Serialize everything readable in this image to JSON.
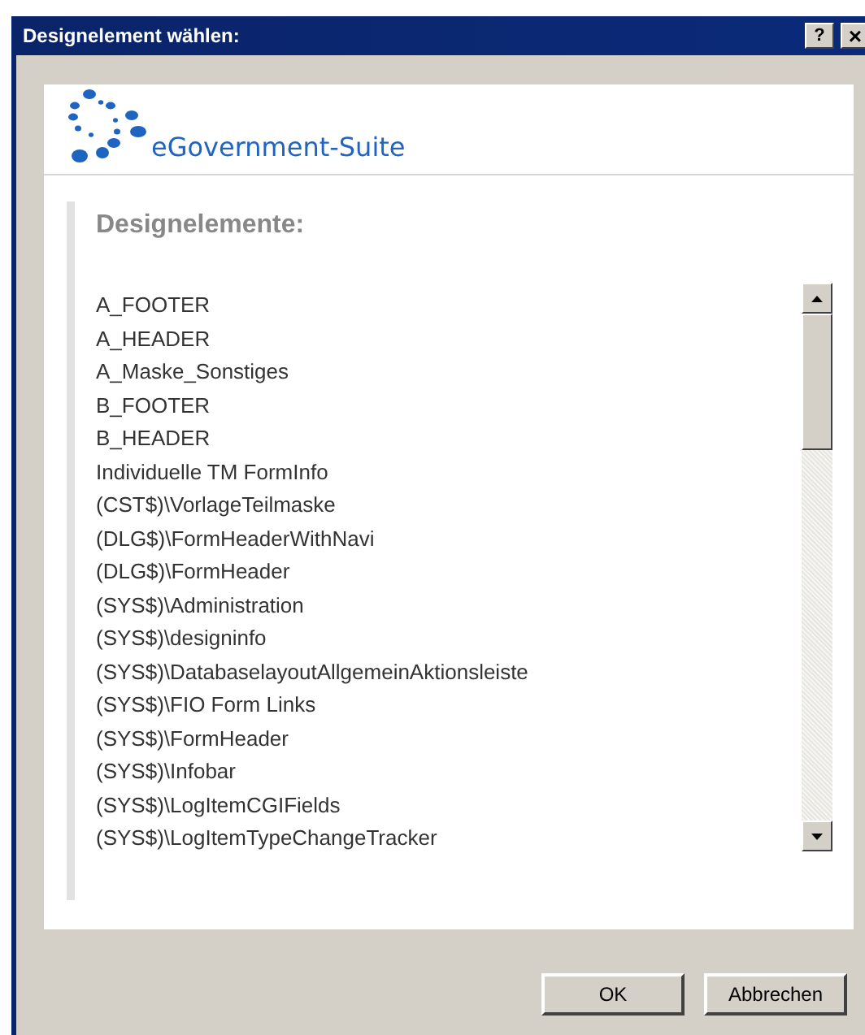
{
  "window": {
    "title": "Designelement wählen:",
    "help_button": "?",
    "close_button": "×"
  },
  "header": {
    "logo_text": "eGovernment-Suite"
  },
  "list": {
    "heading": "Designelemente:",
    "items": [
      "A_FOOTER",
      "A_HEADER",
      "A_Maske_Sonstiges",
      "B_FOOTER",
      "B_HEADER",
      "Individuelle TM FormInfo",
      "(CST$)\\VorlageTeilmaske",
      "(DLG$)\\FormHeaderWithNavi",
      "(DLG$)\\FormHeader",
      "(SYS$)\\Administration",
      "(SYS$)\\designinfo",
      "(SYS$)\\DatabaselayoutAllgemeinAktionsleiste",
      "(SYS$)\\FIO Form Links",
      "(SYS$)\\FormHeader",
      "(SYS$)\\Infobar",
      "(SYS$)\\LogItemCGIFields",
      "(SYS$)\\LogItemTypeChangeTracker"
    ]
  },
  "buttons": [
    "OK",
    "Abbrechen"
  ]
}
